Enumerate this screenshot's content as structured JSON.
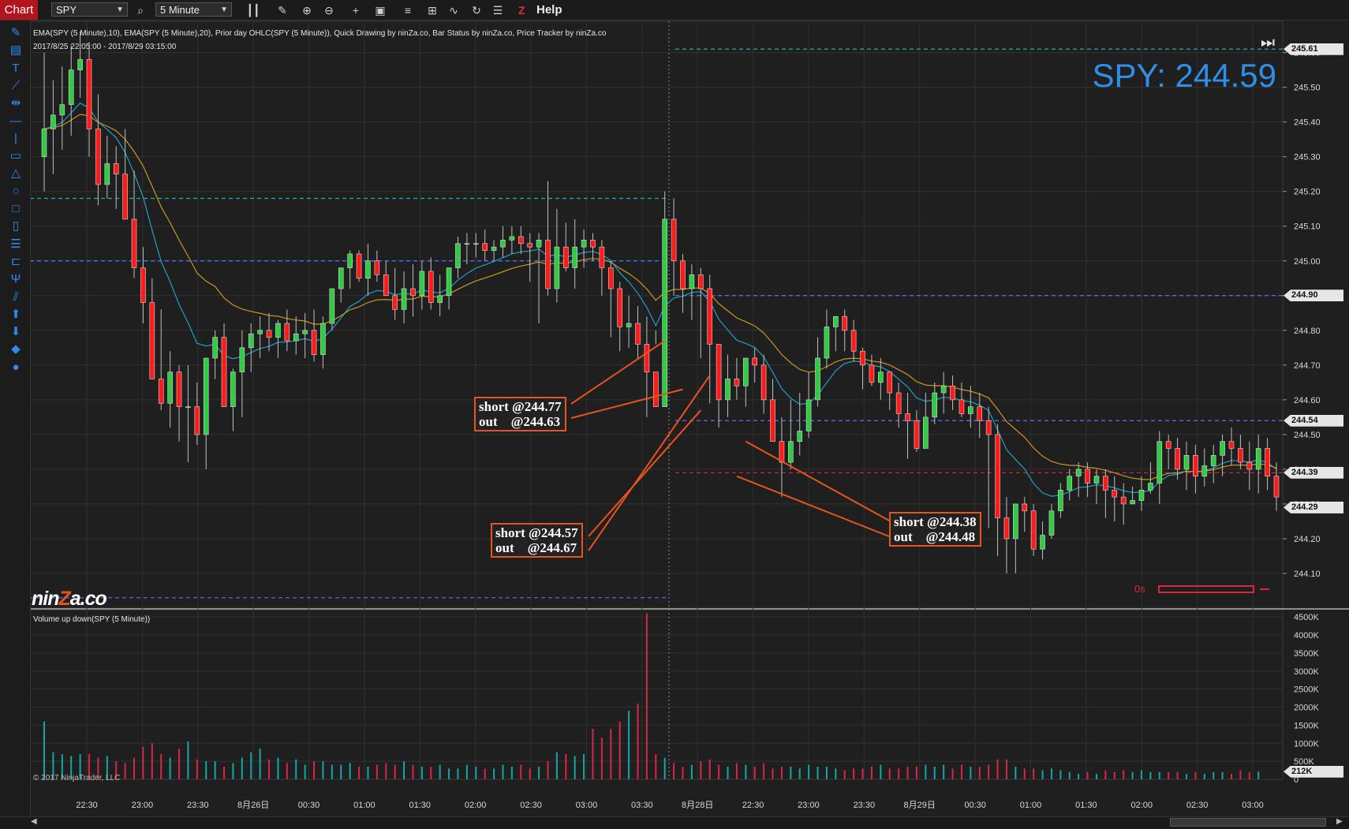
{
  "toolbar": {
    "tab_label": "Chart",
    "instrument": "SPY",
    "interval": "5 Minute",
    "help_label": "Help",
    "help_icon_text": "Z",
    "icons": [
      "search-icon",
      "bar-style-icon",
      "pencil-icon",
      "zoom-in-icon",
      "zoom-out-icon",
      "crosshair-icon",
      "data-box-icon",
      "strategies-icon",
      "indicators-icon",
      "chart-trader-icon",
      "refresh-icon",
      "properties-icon"
    ]
  },
  "left_tools": [
    "pencil-icon",
    "ruler-icon",
    "text-icon",
    "line-icon",
    "extended-line-icon",
    "horizontal-line-icon",
    "vertical-line-icon",
    "rectangle-icon",
    "triangle-icon",
    "ellipse-icon",
    "square-icon",
    "region-icon",
    "fib-icon",
    "time-cycles-icon",
    "pitchfork-icon",
    "trend-channel-icon",
    "arrow-up-icon",
    "arrow-down-icon",
    "diamond-icon",
    "dot-icon"
  ],
  "header": {
    "indicators_line": "EMA(SPY (5 Minute),10), EMA(SPY (5 Minute),20), Prior day OHLC(SPY (5 Minute)), Quick Drawing by ninZa.co, Bar Status by ninZa.co, Price Tracker by ninZa.co",
    "date_range": "2017/8/25 22:05:00 - 2017/8/29 03:15:00"
  },
  "price_tracker": "SPY: 244.59",
  "logo": {
    "pre": "nin",
    "z": "Z",
    "post": "a.co"
  },
  "copyright": "© 2017 NinjaTrader, LLC",
  "volume_title": "Volume up down(SPY (5 Minute))",
  "bar_status": "0s",
  "annotations": [
    {
      "id": "note-1",
      "text": "short @244.77\nout    @244.63"
    },
    {
      "id": "note-2",
      "text": "short @244.57\nout    @244.67"
    },
    {
      "id": "note-3",
      "text": "short @244.38\nout    @244.48"
    }
  ],
  "colors": {
    "background": "#1f1f1f",
    "up_candle": "#2ecc40",
    "down_candle": "#ff1a1a",
    "ema10": "#1fa0c8",
    "ema20": "#c8961e",
    "volume_up": "#13a7a7",
    "volume_down": "#d8264a",
    "accent": "#2f8fe8",
    "annotation": "#e8541e"
  },
  "chart_data": {
    "type": "candlestick",
    "series": [
      {
        "name": "SPY (5 Minute)",
        "kind": "ohlc",
        "x_time": [
          "22:05",
          "22:10",
          "22:15",
          "22:20",
          "22:25",
          "22:30",
          "22:35",
          "22:40",
          "22:45",
          "22:50",
          "22:55",
          "23:00",
          "23:05",
          "23:10",
          "23:15",
          "23:20",
          "23:25",
          "23:30",
          "23:35",
          "23:40",
          "23:45",
          "23:50",
          "23:55",
          "00:00",
          "00:05",
          "00:10",
          "00:15",
          "00:20",
          "00:25",
          "00:30",
          "00:35",
          "00:40",
          "00:45",
          "00:50",
          "00:55",
          "01:00",
          "01:05",
          "01:10",
          "01:15",
          "01:20",
          "01:25",
          "01:30",
          "01:35",
          "01:40",
          "01:45",
          "01:50",
          "01:55",
          "02:00",
          "02:05",
          "02:10",
          "02:15",
          "02:20",
          "02:25",
          "02:30",
          "02:35",
          "02:40",
          "02:45",
          "02:50",
          "02:55",
          "03:00",
          "03:05",
          "03:10",
          "03:15",
          "03:20",
          "03:25",
          "03:30",
          "03:35",
          "03:40",
          "03:45",
          "03:50",
          "03:55",
          "04:00",
          "04:05",
          "04:10",
          "04:15",
          "04:20",
          "04:25",
          "04:30",
          "04:35",
          "04:40",
          "04:45",
          "04:50",
          "04:55",
          "05:00",
          "05:05",
          "05:10",
          "05:15",
          "05:20",
          "05:25",
          "05:30",
          "05:35",
          "05:40",
          "05:45",
          "05:50",
          "05:55",
          "06:00",
          "06:05",
          "06:10",
          "06:15",
          "06:20",
          "06:25",
          "06:30",
          "06:35",
          "06:40",
          "06:45",
          "06:50",
          "06:55",
          "07:00",
          "07:05",
          "07:10",
          "07:15",
          "07:20",
          "07:25",
          "07:30",
          "07:35",
          "07:40",
          "07:45",
          "07:50",
          "07:55",
          "08:00",
          "08:05",
          "08:10",
          "08:15",
          "08:20",
          "08:25",
          "08:30",
          "08:35",
          "08:40",
          "08:45",
          "08:50",
          "08:55",
          "09:00",
          "09:05",
          "09:10",
          "09:15",
          "09:20",
          "09:25",
          "09:30",
          "09:35",
          "09:40",
          "09:45",
          "09:50"
        ],
        "open": [
          245.3,
          245.38,
          245.42,
          245.45,
          245.55,
          245.58,
          245.38,
          245.22,
          245.28,
          245.25,
          245.12,
          244.98,
          244.88,
          244.66,
          244.59,
          244.68,
          244.58,
          244.58,
          244.5,
          244.72,
          244.78,
          244.58,
          244.68,
          244.75,
          244.79,
          244.8,
          244.78,
          244.82,
          244.77,
          244.79,
          244.8,
          244.73,
          244.82,
          244.92,
          244.98,
          245.02,
          244.95,
          245.0,
          244.96,
          244.9,
          244.86,
          244.92,
          244.9,
          244.97,
          244.88,
          244.9,
          244.98,
          245.05,
          245.05,
          245.05,
          245.03,
          245.04,
          245.06,
          245.07,
          245.05,
          245.04,
          245.06,
          244.92,
          245.04,
          244.98,
          245.04,
          245.06,
          245.04,
          244.98,
          244.92,
          244.81,
          244.82,
          244.76,
          244.68,
          244.58,
          245.12,
          245.0,
          244.92,
          244.96,
          244.92,
          244.76,
          244.6,
          244.66,
          244.64,
          244.72,
          244.7,
          244.6,
          244.48,
          244.42,
          244.48,
          244.51,
          244.6,
          244.72,
          244.81,
          244.84,
          244.8,
          244.74,
          244.7,
          244.65,
          244.68,
          244.62,
          244.56,
          244.54,
          244.46,
          244.55,
          244.62,
          244.64,
          244.6,
          244.56,
          244.58,
          244.54,
          244.5,
          244.26,
          244.2,
          244.3,
          244.28,
          244.17,
          244.21,
          244.28,
          244.34,
          244.38,
          244.4,
          244.36,
          244.38,
          244.34,
          244.32,
          244.3,
          244.31,
          244.34,
          244.36,
          244.48,
          244.46,
          244.4,
          244.44,
          244.38,
          244.41,
          244.44,
          244.48,
          244.46,
          244.42,
          244.4,
          244.46,
          244.38
        ],
        "high": [
          245.6,
          245.52,
          245.56,
          245.62,
          245.66,
          245.63,
          245.48,
          245.36,
          245.33,
          245.38,
          245.26,
          245.04,
          244.95,
          244.86,
          244.74,
          244.7,
          244.7,
          244.65,
          244.62,
          244.8,
          244.82,
          244.69,
          244.8,
          244.82,
          244.84,
          244.85,
          244.83,
          244.86,
          244.84,
          244.85,
          244.86,
          244.84,
          244.92,
          244.98,
          245.03,
          245.03,
          245.05,
          245.03,
          245.0,
          244.98,
          244.97,
          244.99,
          245.0,
          245.01,
          244.96,
          244.98,
          245.07,
          245.08,
          245.08,
          245.09,
          245.06,
          245.1,
          245.1,
          245.1,
          245.08,
          245.08,
          245.23,
          245.15,
          245.11,
          245.12,
          245.09,
          245.08,
          245.06,
          245.0,
          244.94,
          244.9,
          244.87,
          244.84,
          244.76,
          245.2,
          245.18,
          245.02,
          244.99,
          244.98,
          244.96,
          244.76,
          244.73,
          244.72,
          244.72,
          244.75,
          244.73,
          244.66,
          244.55,
          244.6,
          244.62,
          244.68,
          244.78,
          244.86,
          244.84,
          244.86,
          244.83,
          244.75,
          244.73,
          244.72,
          244.68,
          244.65,
          244.62,
          244.57,
          244.62,
          244.65,
          244.68,
          244.67,
          244.65,
          244.64,
          244.62,
          244.58,
          244.53,
          244.32,
          244.3,
          244.32,
          244.3,
          244.25,
          244.3,
          244.36,
          244.4,
          244.42,
          244.42,
          244.4,
          244.4,
          244.38,
          244.36,
          244.35,
          244.38,
          244.42,
          244.51,
          244.5,
          244.49,
          244.48,
          244.47,
          244.46,
          244.47,
          244.5,
          244.52,
          244.5,
          244.48,
          244.5,
          244.49,
          244.42
        ],
        "low": [
          245.2,
          245.25,
          245.32,
          245.36,
          245.47,
          245.3,
          245.16,
          245.18,
          245.15,
          245.16,
          244.95,
          244.82,
          244.76,
          244.57,
          244.52,
          244.48,
          244.42,
          244.47,
          244.4,
          244.66,
          244.64,
          244.51,
          244.55,
          244.68,
          244.72,
          244.74,
          244.72,
          244.74,
          244.73,
          244.72,
          244.71,
          244.69,
          244.8,
          244.88,
          244.92,
          244.94,
          244.9,
          244.94,
          244.9,
          244.83,
          244.82,
          244.84,
          244.86,
          244.86,
          244.84,
          244.86,
          244.95,
          244.99,
          245.01,
          245.0,
          245.0,
          245.01,
          245.02,
          245.02,
          244.94,
          244.82,
          244.9,
          244.88,
          244.97,
          244.92,
          244.98,
          245.0,
          244.9,
          244.78,
          244.74,
          244.75,
          244.72,
          244.55,
          244.8,
          244.93,
          244.9,
          244.85,
          244.83,
          244.72,
          244.59,
          244.52,
          244.55,
          244.6,
          244.58,
          244.65,
          244.56,
          244.48,
          244.32,
          244.4,
          244.44,
          244.49,
          244.58,
          244.69,
          244.74,
          244.74,
          244.71,
          244.63,
          244.64,
          244.6,
          244.57,
          244.52,
          244.43,
          244.45,
          244.5,
          244.53,
          244.56,
          244.57,
          244.55,
          244.52,
          244.49,
          244.23,
          244.15,
          244.1,
          244.1,
          244.22,
          244.15,
          244.14,
          244.2,
          244.26,
          244.31,
          244.32,
          244.32,
          244.3,
          244.26,
          244.25,
          244.24,
          244.3,
          244.28,
          244.33,
          244.3,
          244.4,
          244.37,
          244.34,
          244.33,
          244.35,
          244.36,
          244.38,
          244.41,
          244.4,
          244.34,
          244.33,
          244.34,
          244.28
        ],
        "close": [
          245.38,
          245.42,
          245.45,
          245.55,
          245.58,
          245.38,
          245.22,
          245.28,
          245.25,
          245.12,
          244.98,
          244.88,
          244.66,
          244.59,
          244.68,
          244.58,
          244.58,
          244.5,
          244.72,
          244.78,
          244.58,
          244.68,
          244.75,
          244.79,
          244.8,
          244.78,
          244.82,
          244.77,
          244.79,
          244.8,
          244.73,
          244.82,
          244.92,
          244.98,
          245.02,
          244.95,
          245.0,
          244.96,
          244.9,
          244.86,
          244.92,
          244.9,
          244.97,
          244.88,
          244.9,
          244.98,
          245.05,
          245.05,
          245.05,
          245.03,
          245.04,
          245.06,
          245.07,
          245.05,
          245.04,
          245.06,
          244.92,
          245.04,
          244.98,
          245.04,
          245.06,
          245.04,
          244.98,
          244.92,
          244.81,
          244.82,
          244.76,
          244.68,
          244.58,
          245.12,
          245.0,
          244.92,
          244.96,
          244.92,
          244.76,
          244.6,
          244.66,
          244.64,
          244.72,
          244.7,
          244.6,
          244.48,
          244.42,
          244.48,
          244.51,
          244.6,
          244.72,
          244.81,
          244.84,
          244.8,
          244.74,
          244.7,
          244.65,
          244.68,
          244.62,
          244.56,
          244.54,
          244.46,
          244.55,
          244.62,
          244.64,
          244.6,
          244.56,
          244.58,
          244.54,
          244.5,
          244.26,
          244.2,
          244.3,
          244.28,
          244.17,
          244.21,
          244.28,
          244.34,
          244.38,
          244.4,
          244.36,
          244.38,
          244.34,
          244.32,
          244.3,
          244.31,
          244.34,
          244.36,
          244.48,
          244.46,
          244.4,
          244.44,
          244.38,
          244.41,
          244.44,
          244.48,
          244.46,
          244.42,
          244.4,
          244.46,
          244.38,
          244.32
        ]
      },
      {
        "name": "EMA(SPY (5 Minute),10)",
        "kind": "line",
        "period": 10
      },
      {
        "name": "EMA(SPY (5 Minute),20)",
        "kind": "line",
        "period": 20
      },
      {
        "name": "Volume up down(SPY (5 Minute))",
        "kind": "volume",
        "values": [
          1600,
          750,
          700,
          650,
          700,
          700,
          600,
          650,
          500,
          450,
          600,
          900,
          1000,
          700,
          600,
          850,
          1050,
          550,
          500,
          500,
          350,
          450,
          600,
          750,
          850,
          550,
          600,
          450,
          550,
          400,
          500,
          500,
          400,
          400,
          450,
          350,
          350,
          400,
          450,
          400,
          500,
          400,
          350,
          350,
          400,
          300,
          300,
          400,
          350,
          300,
          300,
          400,
          350,
          400,
          300,
          350,
          500,
          750,
          700,
          650,
          700,
          1400,
          1150,
          1400,
          1600,
          1900,
          2100,
          4600,
          700,
          600,
          450,
          350,
          400,
          500,
          550,
          400,
          350,
          450,
          400,
          350,
          450,
          300,
          350,
          350,
          300,
          400,
          350,
          350,
          300,
          250,
          300,
          300,
          350,
          400,
          300,
          300,
          350,
          350,
          400,
          350,
          400,
          300,
          400,
          350,
          350,
          400,
          550,
          550,
          350,
          300,
          300,
          250,
          300,
          250,
          200,
          150,
          200,
          150,
          250,
          200,
          250,
          200,
          250,
          200,
          200,
          200,
          200,
          150,
          200,
          150,
          200,
          200,
          150,
          250,
          200,
          212
        ]
      }
    ],
    "horizontal_levels": [
      {
        "price": 245.61,
        "label": "245.61",
        "color": "#17b3b3",
        "style": "dashed"
      },
      {
        "price": 245.18,
        "color": "#17b3b3",
        "style": "dashed"
      },
      {
        "price": 245.0,
        "color": "#4a7cff",
        "style": "dashed"
      },
      {
        "price": 244.9,
        "label": "244.90",
        "color": "#6a6aff",
        "style": "dashed"
      },
      {
        "price": 244.54,
        "label": "244.54",
        "color": "#6a6aff",
        "style": "dashed"
      },
      {
        "price": 244.39,
        "label": "244.39",
        "color": "#e0234a",
        "style": "dashed"
      },
      {
        "price": 244.03,
        "color": "#6a6aff",
        "style": "dashed"
      }
    ],
    "current_price_label": "244.29",
    "volume_last_label": "212K",
    "ylim": [
      244.0,
      245.69
    ],
    "y_ticks": [
      "245.60",
      "245.50",
      "245.40",
      "245.30",
      "245.20",
      "245.10",
      "245.00",
      "244.90",
      "244.80",
      "244.70",
      "244.60",
      "244.50",
      "244.40",
      "244.30",
      "244.20",
      "244.10"
    ],
    "volume_ylim": [
      0,
      4700
    ],
    "volume_ticks": [
      "4500K",
      "4000K",
      "3500K",
      "3000K",
      "2500K",
      "2000K",
      "1500K",
      "1000K",
      "500K",
      "0"
    ],
    "x_ticks": [
      "22:30",
      "23:00",
      "23:30",
      "8月26日",
      "00:30",
      "01:00",
      "01:30",
      "02:00",
      "02:30",
      "03:00",
      "03:30",
      "8月28日",
      "22:30",
      "23:00",
      "23:30",
      "8月29日",
      "00:30",
      "01:00",
      "01:30",
      "02:00",
      "02:30",
      "03:00"
    ],
    "grid": true
  }
}
